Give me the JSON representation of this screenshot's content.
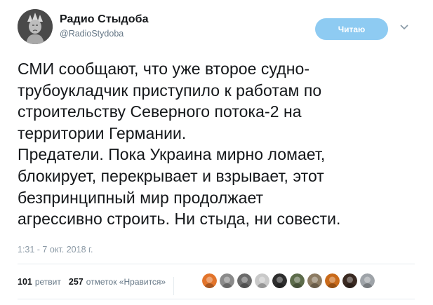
{
  "author": {
    "name": "Радио Стыдоба",
    "handle": "@RadioStydoba"
  },
  "follow_button": "Читаю",
  "tweet_lines": [
    "СМИ сообщают, что уже второе судно-",
    "трубоукладчик приступило к работам по",
    "строительству Северного потока-2 на",
    "территории Германии.",
    "Предатели. Пока Украина мирно ломает,",
    "блокирует, перекрывает и взрывает, этот",
    "безпринципный мир продолжает",
    "агрессивно строить.  Ни стыда, ни совести."
  ],
  "timestamp": "1:31 - 7 окт. 2018 г.",
  "stats": {
    "retweets_count": "101",
    "retweets_label": "ретвит",
    "likes_count": "257",
    "likes_label": "отметок «Нравится»"
  },
  "likers": [
    {
      "icon": "fox-avatar",
      "color": "#e2742b"
    },
    {
      "icon": "face-avatar",
      "color": "#8a8a8a"
    },
    {
      "icon": "raccoon-avatar",
      "color": "#6b6b6b"
    },
    {
      "icon": "bearded-man-avatar",
      "color": "#c9c9c9"
    },
    {
      "icon": "coat-of-arms-avatar",
      "color": "#2e2e2e"
    },
    {
      "icon": "cat-avatar",
      "color": "#5c6b4a"
    },
    {
      "icon": "portrait-avatar",
      "color": "#8c7b62"
    },
    {
      "icon": "orange-avatar",
      "color": "#c96a1a"
    },
    {
      "icon": "dark-avatar",
      "color": "#3a2a22"
    },
    {
      "icon": "grey-man-avatar",
      "color": "#9ea3a8"
    }
  ]
}
